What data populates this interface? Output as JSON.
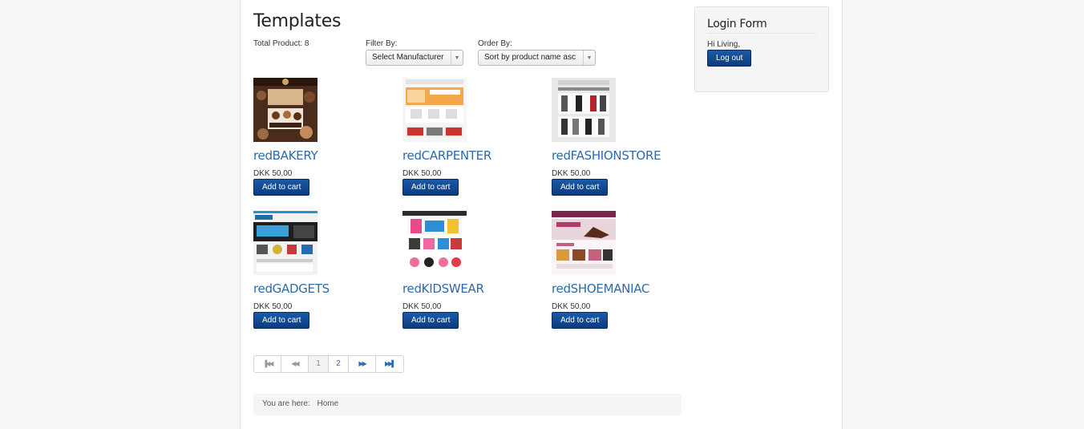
{
  "page": {
    "title": "Templates"
  },
  "toolbar": {
    "total_label": "Total Product: 8",
    "filter_label": "Filter By:",
    "filter_value": "Select Manufacturer",
    "order_label": "Order By:",
    "order_value": "Sort by product name asc"
  },
  "products": [
    {
      "name": "redBAKERY",
      "price": "DKK 50,00",
      "button": "Add to cart"
    },
    {
      "name": "redCARPENTER",
      "price": "DKK 50,00",
      "button": "Add to cart"
    },
    {
      "name": "redFASHIONSTORE",
      "price": "DKK 50,00",
      "button": "Add to cart"
    },
    {
      "name": "redGADGETS",
      "price": "DKK 50,00",
      "button": "Add to cart"
    },
    {
      "name": "redKIDSWEAR",
      "price": "DKK 50,00",
      "button": "Add to cart"
    },
    {
      "name": "redSHOEMANIAC",
      "price": "DKK 50,00",
      "button": "Add to cart"
    }
  ],
  "pagination": {
    "first": "first-page-icon",
    "prev": "previous-page-icon",
    "pages": [
      "1",
      "2"
    ],
    "current": "1",
    "next": "next-page-icon",
    "last": "last-page-icon"
  },
  "breadcrumb": {
    "prefix": "You are here:",
    "home": "Home"
  },
  "login": {
    "title": "Login Form",
    "greeting": "Hi Living,",
    "logout": "Log out"
  },
  "colors": {
    "link": "#2a6ab2",
    "button": "#0b3b7d"
  }
}
